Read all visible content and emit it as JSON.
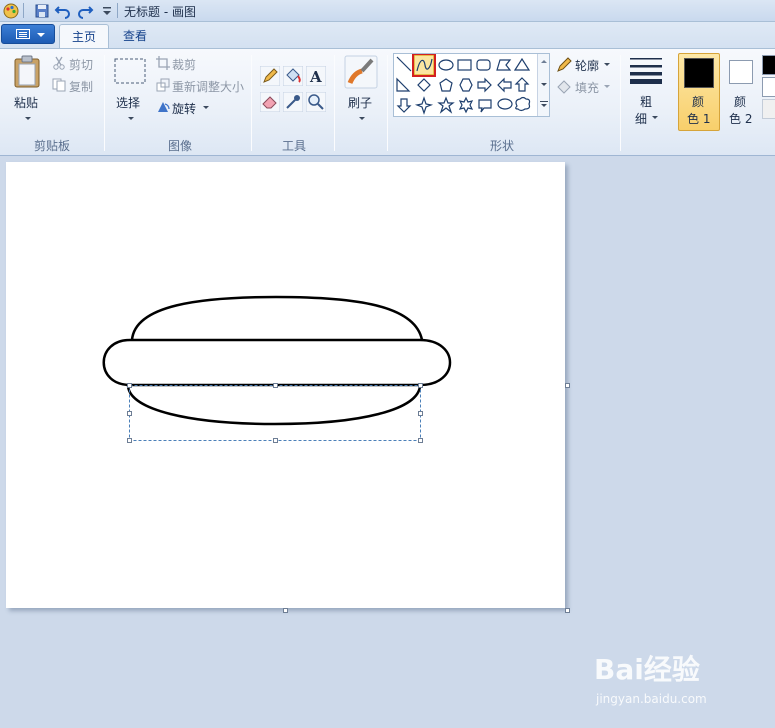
{
  "window": {
    "title": "无标题 - 画图"
  },
  "tabs": [
    {
      "label": "主页"
    },
    {
      "label": "查看"
    }
  ],
  "clipboard": {
    "paste": "粘贴",
    "cut": "剪切",
    "copy": "复制",
    "group": "剪贴板"
  },
  "image": {
    "select": "选择",
    "crop": "裁剪",
    "resize": "重新调整大小",
    "rotate": "旋转",
    "group": "图像"
  },
  "tools": {
    "group": "工具"
  },
  "brushes": {
    "label": "刷子"
  },
  "shapes": {
    "outline": "轮廓",
    "fill": "填充",
    "group": "形状",
    "selected": "curve"
  },
  "size": {
    "label_top": "粗",
    "label_bottom": "细"
  },
  "colors": {
    "color1_label_top": "颜",
    "color1_label_bottom": "色 1",
    "color2_label_top": "颜",
    "color2_label_bottom": "色 2",
    "color1": "#000000",
    "color2": "#ffffff"
  },
  "watermark": {
    "main": "Bai经验",
    "sub": "jingyan.baidu.com"
  }
}
